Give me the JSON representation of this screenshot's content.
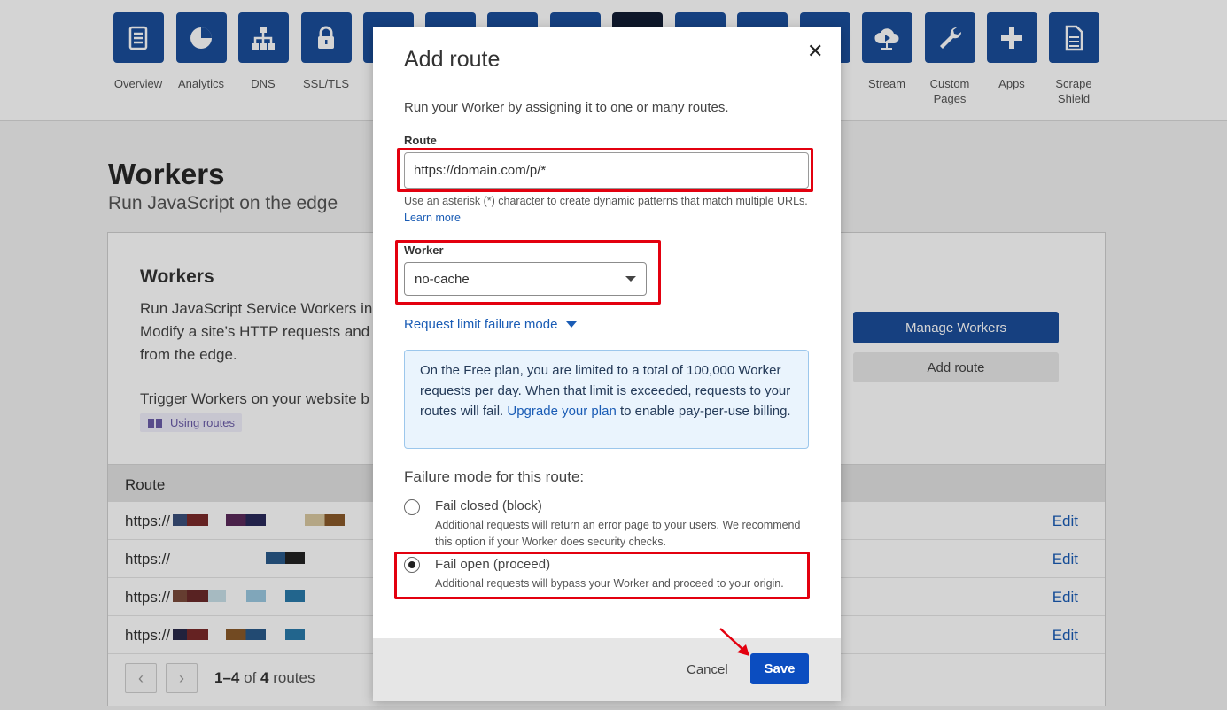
{
  "nav": {
    "items": [
      {
        "label": "Overview",
        "icon": "document-list-icon"
      },
      {
        "label": "Analytics",
        "icon": "pie-chart-icon"
      },
      {
        "label": "DNS",
        "icon": "network-tree-icon"
      },
      {
        "label": "SSL/TLS",
        "icon": "lock-icon"
      },
      {
        "label": "Stream",
        "icon": "cloud-play-icon"
      },
      {
        "label": "Custom Pages",
        "icon": "wrench-icon"
      },
      {
        "label": "Apps",
        "icon": "plus-icon"
      },
      {
        "label": "Scrape Shield",
        "icon": "document-icon"
      }
    ]
  },
  "page": {
    "title": "Workers",
    "subtitle": "Run JavaScript on the edge"
  },
  "card": {
    "title": "Workers",
    "description": "Run JavaScript Service Workers in Modify a site’s HTTP requests and from the edge.",
    "trigger_text": "Trigger Workers on your website b",
    "using_routes_label": "Using routes",
    "manage_button": "Manage Workers",
    "add_route_button": "Add route"
  },
  "table": {
    "header": "Route",
    "rows": [
      {
        "route": "https://",
        "action": "Edit"
      },
      {
        "route": "https://",
        "action": "Edit"
      },
      {
        "route": "https://",
        "action": "Edit"
      },
      {
        "route": "https://",
        "action": "Edit"
      }
    ],
    "pager_range": "1–4",
    "pager_of": "of",
    "pager_total": "4",
    "pager_unit": "routes"
  },
  "modal": {
    "title": "Add route",
    "close_glyph": "✕",
    "intro": "Run your Worker by assigning it to one or many routes.",
    "route_label": "Route",
    "route_value": "https://domain.com/p/*",
    "route_hint": "Use an asterisk (*) character to create dynamic patterns that match multiple URLs.",
    "learn_more": "Learn more",
    "worker_label": "Worker",
    "worker_value": "no-cache",
    "limit_toggle": "Request limit failure mode",
    "info_before": "On the Free plan, you are limited to a total of 100,000 Worker requests per day. When that limit is exceeded, requests to your routes will fail.",
    "info_link": "Upgrade your plan",
    "info_after": "to enable pay-per-use billing.",
    "failure_heading": "Failure mode for this route:",
    "options": [
      {
        "title": "Fail closed (block)",
        "desc": "Additional requests will return an error page to your users. We recommend this option if your Worker does security checks.",
        "selected": false
      },
      {
        "title": "Fail open (proceed)",
        "desc": "Additional requests will bypass your Worker and proceed to your origin.",
        "selected": true
      }
    ],
    "cancel": "Cancel",
    "save": "Save"
  },
  "colors": {
    "nav_tile": "#1a4e9b",
    "primary_button": "#0b4dc0",
    "link": "#1a5cb5",
    "highlight": "#e3000f"
  }
}
